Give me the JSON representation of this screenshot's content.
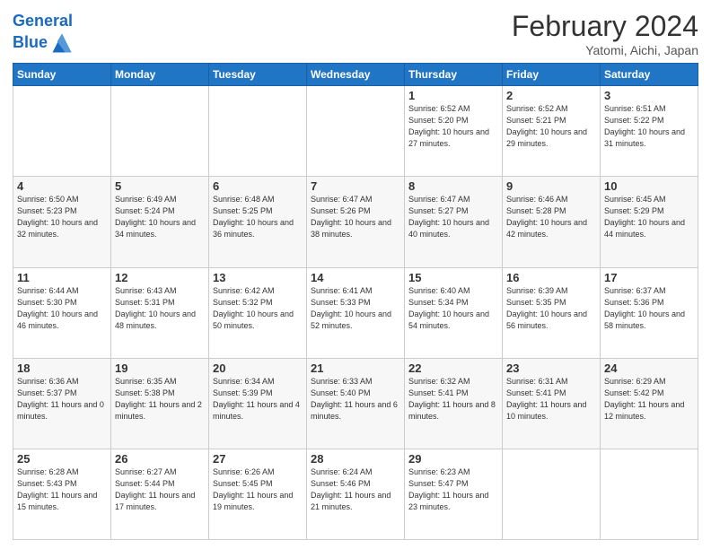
{
  "header": {
    "logo_line1": "General",
    "logo_line2": "Blue",
    "month_title": "February 2024",
    "location": "Yatomi, Aichi, Japan"
  },
  "weekdays": [
    "Sunday",
    "Monday",
    "Tuesday",
    "Wednesday",
    "Thursday",
    "Friday",
    "Saturday"
  ],
  "rows": [
    [
      {
        "day": "",
        "info": ""
      },
      {
        "day": "",
        "info": ""
      },
      {
        "day": "",
        "info": ""
      },
      {
        "day": "",
        "info": ""
      },
      {
        "day": "1",
        "info": "Sunrise: 6:52 AM\nSunset: 5:20 PM\nDaylight: 10 hours\nand 27 minutes."
      },
      {
        "day": "2",
        "info": "Sunrise: 6:52 AM\nSunset: 5:21 PM\nDaylight: 10 hours\nand 29 minutes."
      },
      {
        "day": "3",
        "info": "Sunrise: 6:51 AM\nSunset: 5:22 PM\nDaylight: 10 hours\nand 31 minutes."
      }
    ],
    [
      {
        "day": "4",
        "info": "Sunrise: 6:50 AM\nSunset: 5:23 PM\nDaylight: 10 hours\nand 32 minutes."
      },
      {
        "day": "5",
        "info": "Sunrise: 6:49 AM\nSunset: 5:24 PM\nDaylight: 10 hours\nand 34 minutes."
      },
      {
        "day": "6",
        "info": "Sunrise: 6:48 AM\nSunset: 5:25 PM\nDaylight: 10 hours\nand 36 minutes."
      },
      {
        "day": "7",
        "info": "Sunrise: 6:47 AM\nSunset: 5:26 PM\nDaylight: 10 hours\nand 38 minutes."
      },
      {
        "day": "8",
        "info": "Sunrise: 6:47 AM\nSunset: 5:27 PM\nDaylight: 10 hours\nand 40 minutes."
      },
      {
        "day": "9",
        "info": "Sunrise: 6:46 AM\nSunset: 5:28 PM\nDaylight: 10 hours\nand 42 minutes."
      },
      {
        "day": "10",
        "info": "Sunrise: 6:45 AM\nSunset: 5:29 PM\nDaylight: 10 hours\nand 44 minutes."
      }
    ],
    [
      {
        "day": "11",
        "info": "Sunrise: 6:44 AM\nSunset: 5:30 PM\nDaylight: 10 hours\nand 46 minutes."
      },
      {
        "day": "12",
        "info": "Sunrise: 6:43 AM\nSunset: 5:31 PM\nDaylight: 10 hours\nand 48 minutes."
      },
      {
        "day": "13",
        "info": "Sunrise: 6:42 AM\nSunset: 5:32 PM\nDaylight: 10 hours\nand 50 minutes."
      },
      {
        "day": "14",
        "info": "Sunrise: 6:41 AM\nSunset: 5:33 PM\nDaylight: 10 hours\nand 52 minutes."
      },
      {
        "day": "15",
        "info": "Sunrise: 6:40 AM\nSunset: 5:34 PM\nDaylight: 10 hours\nand 54 minutes."
      },
      {
        "day": "16",
        "info": "Sunrise: 6:39 AM\nSunset: 5:35 PM\nDaylight: 10 hours\nand 56 minutes."
      },
      {
        "day": "17",
        "info": "Sunrise: 6:37 AM\nSunset: 5:36 PM\nDaylight: 10 hours\nand 58 minutes."
      }
    ],
    [
      {
        "day": "18",
        "info": "Sunrise: 6:36 AM\nSunset: 5:37 PM\nDaylight: 11 hours\nand 0 minutes."
      },
      {
        "day": "19",
        "info": "Sunrise: 6:35 AM\nSunset: 5:38 PM\nDaylight: 11 hours\nand 2 minutes."
      },
      {
        "day": "20",
        "info": "Sunrise: 6:34 AM\nSunset: 5:39 PM\nDaylight: 11 hours\nand 4 minutes."
      },
      {
        "day": "21",
        "info": "Sunrise: 6:33 AM\nSunset: 5:40 PM\nDaylight: 11 hours\nand 6 minutes."
      },
      {
        "day": "22",
        "info": "Sunrise: 6:32 AM\nSunset: 5:41 PM\nDaylight: 11 hours\nand 8 minutes."
      },
      {
        "day": "23",
        "info": "Sunrise: 6:31 AM\nSunset: 5:41 PM\nDaylight: 11 hours\nand 10 minutes."
      },
      {
        "day": "24",
        "info": "Sunrise: 6:29 AM\nSunset: 5:42 PM\nDaylight: 11 hours\nand 12 minutes."
      }
    ],
    [
      {
        "day": "25",
        "info": "Sunrise: 6:28 AM\nSunset: 5:43 PM\nDaylight: 11 hours\nand 15 minutes."
      },
      {
        "day": "26",
        "info": "Sunrise: 6:27 AM\nSunset: 5:44 PM\nDaylight: 11 hours\nand 17 minutes."
      },
      {
        "day": "27",
        "info": "Sunrise: 6:26 AM\nSunset: 5:45 PM\nDaylight: 11 hours\nand 19 minutes."
      },
      {
        "day": "28",
        "info": "Sunrise: 6:24 AM\nSunset: 5:46 PM\nDaylight: 11 hours\nand 21 minutes."
      },
      {
        "day": "29",
        "info": "Sunrise: 6:23 AM\nSunset: 5:47 PM\nDaylight: 11 hours\nand 23 minutes."
      },
      {
        "day": "",
        "info": ""
      },
      {
        "day": "",
        "info": ""
      }
    ]
  ]
}
